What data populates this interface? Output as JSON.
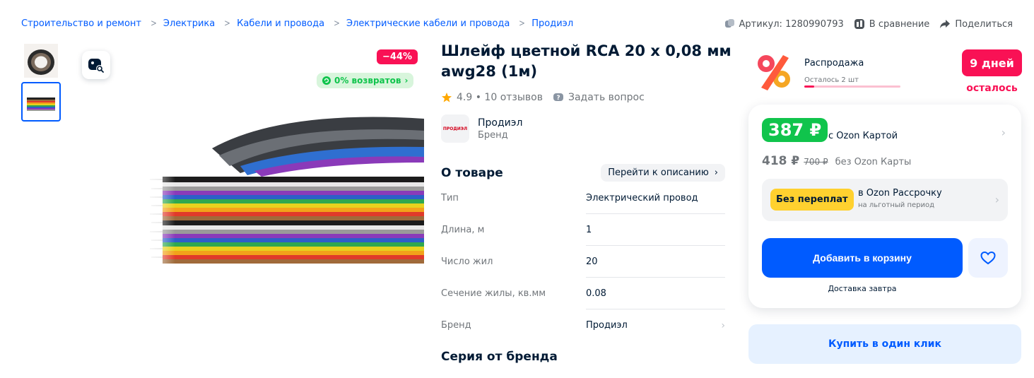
{
  "breadcrumb": {
    "items": [
      "Строительство и ремонт",
      "Электрика",
      "Кабели и провода",
      "Электрические кабели и провода",
      "Продиэл"
    ],
    "separator": ">"
  },
  "top_actions": {
    "article": "Артикул: 1280990793",
    "compare": "В сравнение",
    "share": "Поделиться"
  },
  "gallery": {
    "discount_badge": "−44%",
    "returns_badge": "0% возвратов",
    "thumbnails": 2,
    "active_thumbnail": 2
  },
  "product": {
    "title": "Шлейф цветной RCA 20 x 0,08 мм awg28 (1м)",
    "rating_text": "4.9 • 10 отзывов",
    "ask_question": "Задать вопрос",
    "brand": {
      "logo_text": "ПРОДИЭЛ",
      "name": "Продиэл",
      "label": "Бренд"
    }
  },
  "about": {
    "title": "О товаре",
    "go_to_description": "Перейти к описанию",
    "specs": [
      {
        "key": "Тип",
        "value": "Электрический провод"
      },
      {
        "key": "Длина, м",
        "value": "1"
      },
      {
        "key": "Число жил",
        "value": "20"
      },
      {
        "key": "Сечение жилы, кв.мм",
        "value": "0.08"
      },
      {
        "key": "Бренд",
        "value": "Продиэл"
      }
    ]
  },
  "series": {
    "title": "Серия от бренда"
  },
  "sale": {
    "title": "Распродажа",
    "remaining": "Осталось 2 шт",
    "remaining_fraction": 0.1,
    "days_badge": "9 дней",
    "days_label": "осталось"
  },
  "price_card": {
    "card_price": "387 ₽",
    "card_price_label": "с Ozon Картой",
    "regular_price": "418 ₽",
    "old_price": "700 ₽",
    "regular_label": "без Ozon Карты",
    "installment": {
      "badge": "Без переплат",
      "title": "в Ozon Рассрочку",
      "subtitle": "на льготный период"
    },
    "add_to_cart": "Добавить в корзину",
    "delivery": "Доставка завтра"
  },
  "one_click": "Купить в один клик",
  "colors": {
    "link": "#005bff",
    "discount": "#f91155",
    "green": "#10c44c",
    "yellow": "#ffd12f"
  }
}
